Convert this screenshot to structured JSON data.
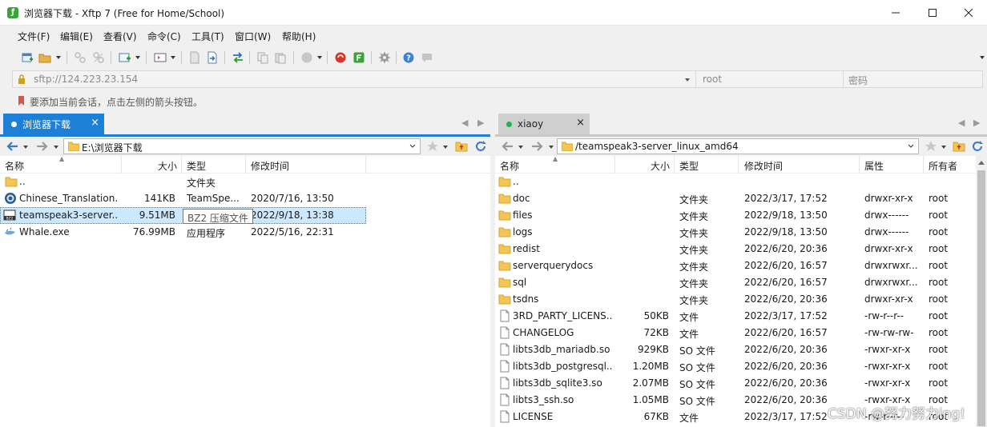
{
  "window": {
    "title": "浏览器下载 - Xftp 7 (Free for Home/School)",
    "app_icon_letter": "ƒ"
  },
  "menu": [
    "文件(F)",
    "编辑(E)",
    "查看(V)",
    "命令(C)",
    "工具(T)",
    "窗口(W)",
    "帮助(H)"
  ],
  "address": {
    "host": "sftp://124.223.23.154",
    "user_placeholder": "root",
    "password_placeholder": "密码"
  },
  "hint": "要添加当前会话，点击左侧的箭头按钮。",
  "left": {
    "tab_label": "浏览器下载",
    "tab_dot_color": "#ffffff",
    "path": "E:\\浏览器下载",
    "columns": [
      "名称",
      "大小",
      "类型",
      "修改时间"
    ],
    "rows": [
      {
        "name": "..",
        "size": "",
        "type": "文件夹",
        "modified": "",
        "icon": "folder-icon"
      },
      {
        "name": "Chinese_Translation...",
        "size": "141KB",
        "type": "TeamSpe...",
        "modified": "2020/7/16, 13:50",
        "icon": "teamspeak-file-icon"
      },
      {
        "name": "teamspeak3-server...",
        "size": "9.51MB",
        "type": "BZ2 压缩文件",
        "modified": "2022/9/18, 13:38",
        "icon": "archive-icon"
      },
      {
        "name": "Whale.exe",
        "size": "76.99MB",
        "type": "应用程序",
        "modified": "2022/5/16, 22:31",
        "icon": "exe-icon"
      }
    ],
    "tooltip": "BZ2 压缩文件"
  },
  "right": {
    "tab_label": "xiaoy",
    "tab_dot_color": "#22b14c",
    "path": "/teamspeak3-server_linux_amd64",
    "columns": [
      "名称",
      "大小",
      "类型",
      "修改时间",
      "属性",
      "所有者"
    ],
    "rows": [
      {
        "name": "..",
        "size": "",
        "type": "",
        "modified": "",
        "attr": "",
        "owner": "",
        "icon": "folder-icon"
      },
      {
        "name": "doc",
        "size": "",
        "type": "文件夹",
        "modified": "2022/3/17, 17:52",
        "attr": "drwxr-xr-x",
        "owner": "root",
        "icon": "folder-icon"
      },
      {
        "name": "files",
        "size": "",
        "type": "文件夹",
        "modified": "2022/9/18, 13:50",
        "attr": "drwx------",
        "owner": "root",
        "icon": "folder-icon"
      },
      {
        "name": "logs",
        "size": "",
        "type": "文件夹",
        "modified": "2022/9/18, 13:50",
        "attr": "drwx------",
        "owner": "root",
        "icon": "folder-icon"
      },
      {
        "name": "redist",
        "size": "",
        "type": "文件夹",
        "modified": "2022/6/20, 20:36",
        "attr": "drwxr-xr-x",
        "owner": "root",
        "icon": "folder-icon"
      },
      {
        "name": "serverquerydocs",
        "size": "",
        "type": "文件夹",
        "modified": "2022/6/20, 16:57",
        "attr": "drwxrwxr...",
        "owner": "root",
        "icon": "folder-icon"
      },
      {
        "name": "sql",
        "size": "",
        "type": "文件夹",
        "modified": "2022/6/20, 16:57",
        "attr": "drwxrwxr...",
        "owner": "root",
        "icon": "folder-icon"
      },
      {
        "name": "tsdns",
        "size": "",
        "type": "文件夹",
        "modified": "2022/6/20, 20:36",
        "attr": "drwxr-xr-x",
        "owner": "root",
        "icon": "folder-icon"
      },
      {
        "name": "3RD_PARTY_LICENS...",
        "size": "50KB",
        "type": "文件",
        "modified": "2022/3/17, 17:52",
        "attr": "-rw-r--r--",
        "owner": "root",
        "icon": "file-icon"
      },
      {
        "name": "CHANGELOG",
        "size": "72KB",
        "type": "文件",
        "modified": "2022/6/20, 16:57",
        "attr": "-rw-rw-rw-",
        "owner": "root",
        "icon": "file-icon"
      },
      {
        "name": "libts3db_mariadb.so",
        "size": "929KB",
        "type": "SO 文件",
        "modified": "2022/6/20, 20:36",
        "attr": "-rwxr-xr-x",
        "owner": "root",
        "icon": "file-icon"
      },
      {
        "name": "libts3db_postgresql...",
        "size": "1.20MB",
        "type": "SO 文件",
        "modified": "2022/6/20, 20:36",
        "attr": "-rwxr-xr-x",
        "owner": "root",
        "icon": "file-icon"
      },
      {
        "name": "libts3db_sqlite3.so",
        "size": "2.07MB",
        "type": "SO 文件",
        "modified": "2022/6/20, 20:36",
        "attr": "-rwxr-xr-x",
        "owner": "root",
        "icon": "file-icon"
      },
      {
        "name": "libts3_ssh.so",
        "size": "1.05MB",
        "type": "SO 文件",
        "modified": "2022/6/20, 20:36",
        "attr": "-rwxr-xr-x",
        "owner": "root",
        "icon": "file-icon"
      },
      {
        "name": "LICENSE",
        "size": "67KB",
        "type": "文件",
        "modified": "2022/3/17, 17:52",
        "attr": "-rw-r--r--",
        "owner": "root",
        "icon": "file-icon"
      }
    ]
  },
  "watermark": "CSDN @努力努力ing!",
  "colors": {
    "accent": "#1e7fd6",
    "selection": "#cce8ff",
    "right_accent": "#c8c8c8"
  }
}
